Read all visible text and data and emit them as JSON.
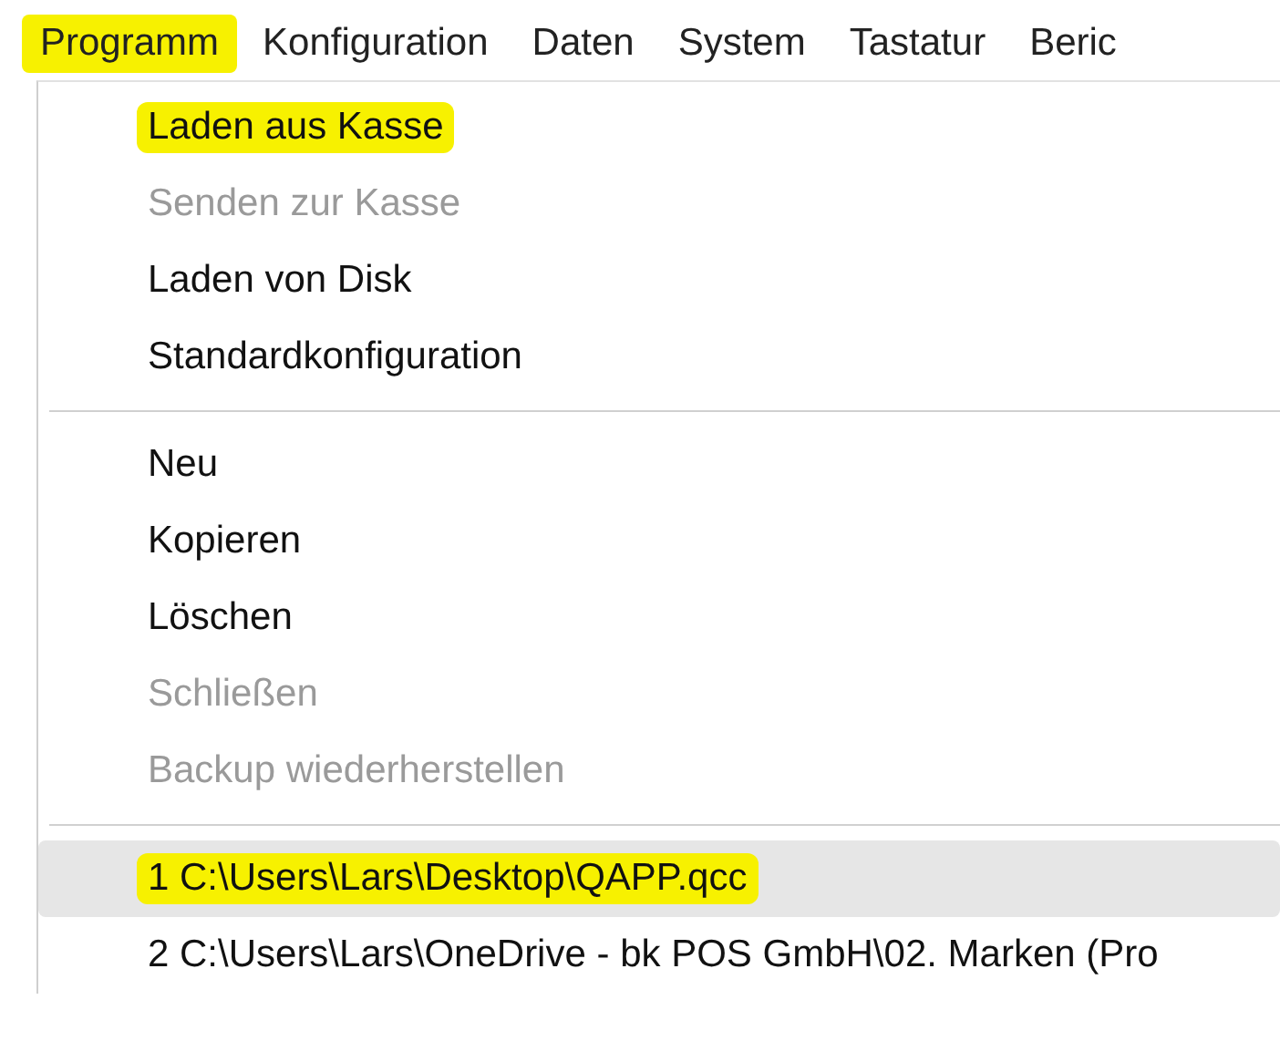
{
  "menu_bar": [
    {
      "label": "Programm",
      "highlighted": true
    },
    {
      "label": "Konfiguration",
      "highlighted": false
    },
    {
      "label": "Daten",
      "highlighted": false
    },
    {
      "label": "System",
      "highlighted": false
    },
    {
      "label": "Tastatur",
      "highlighted": false
    },
    {
      "label": "Beric",
      "highlighted": false
    }
  ],
  "menu": {
    "items": [
      {
        "kind": "item",
        "label": "Laden aus Kasse",
        "disabled": false,
        "highlighted": true,
        "selected": false
      },
      {
        "kind": "item",
        "label": "Senden zur Kasse",
        "disabled": true,
        "highlighted": false,
        "selected": false
      },
      {
        "kind": "item",
        "label": "Laden von Disk",
        "disabled": false,
        "highlighted": false,
        "selected": false
      },
      {
        "kind": "item",
        "label": "Standardkonfiguration",
        "disabled": false,
        "highlighted": false,
        "selected": false
      },
      {
        "kind": "separator"
      },
      {
        "kind": "item",
        "label": "Neu",
        "disabled": false,
        "highlighted": false,
        "selected": false
      },
      {
        "kind": "item",
        "label": "Kopieren",
        "disabled": false,
        "highlighted": false,
        "selected": false
      },
      {
        "kind": "item",
        "label": "Löschen",
        "disabled": false,
        "highlighted": false,
        "selected": false
      },
      {
        "kind": "item",
        "label": "Schließen",
        "disabled": true,
        "highlighted": false,
        "selected": false
      },
      {
        "kind": "item",
        "label": "Backup wiederherstellen",
        "disabled": true,
        "highlighted": false,
        "selected": false
      },
      {
        "kind": "separator"
      },
      {
        "kind": "item",
        "label": "1 C:\\Users\\Lars\\Desktop\\QAPP.qcc",
        "disabled": false,
        "highlighted": true,
        "selected": true
      },
      {
        "kind": "item",
        "label": "2 C:\\Users\\Lars\\OneDrive - bk POS GmbH\\02. Marken (Pro",
        "disabled": false,
        "highlighted": false,
        "selected": false
      }
    ]
  }
}
